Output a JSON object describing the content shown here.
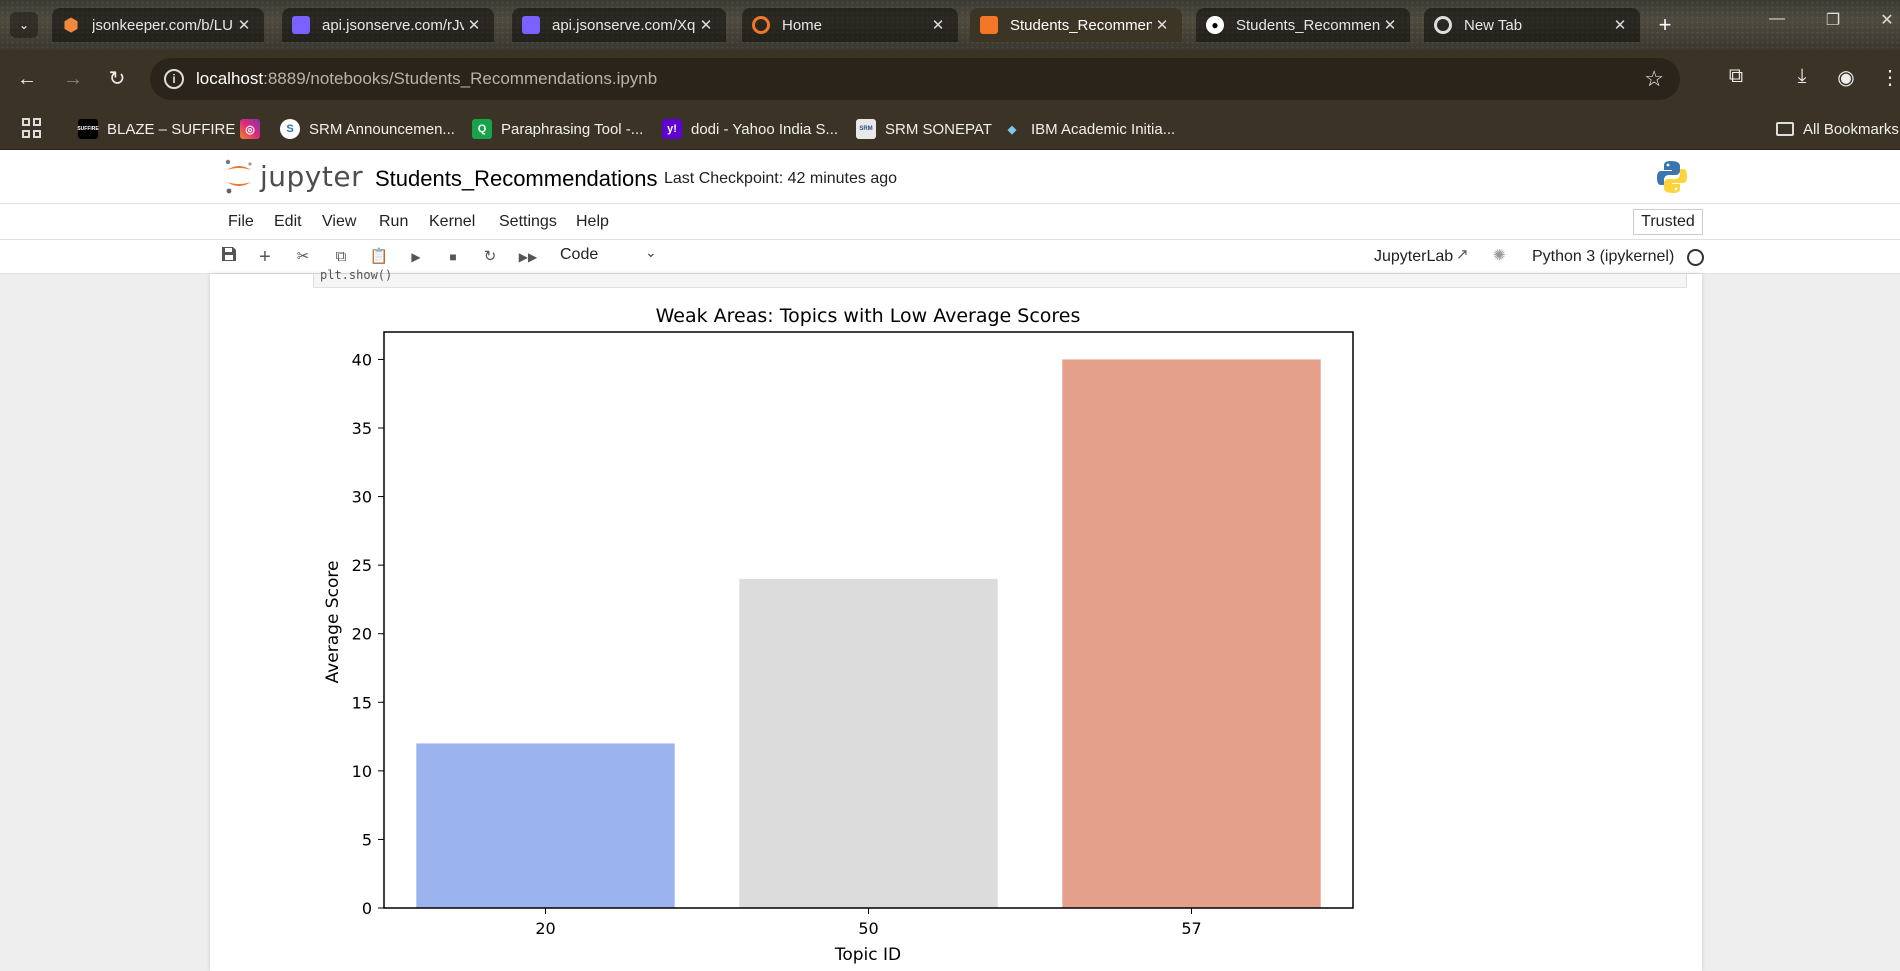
{
  "browser": {
    "tabs": [
      {
        "title": "jsonkeeper.com/b/LU",
        "favicon": "hexagon-icon",
        "color": "#f0883e"
      },
      {
        "title": "api.jsonserve.com/rJv",
        "favicon": "jsonserve-icon",
        "color": "#7b61ff"
      },
      {
        "title": "api.jsonserve.com/Xq",
        "favicon": "jsonserve-icon",
        "color": "#7b61ff"
      },
      {
        "title": "Home",
        "favicon": "jupyter-icon",
        "color": "#f37726"
      },
      {
        "title": "Students_Recommen",
        "favicon": "notebook-icon",
        "color": "#f37726"
      },
      {
        "title": "Students_Recommen",
        "favicon": "github-icon",
        "color": "#ffffff"
      },
      {
        "title": "New Tab",
        "favicon": "chrome-icon",
        "color": "#dddddd"
      }
    ],
    "url_host": "localhost",
    "url_rest": ":8889/notebooks/Students_Recommendations.ipynb",
    "bookmarks": [
      {
        "label": "BLAZE – SUFFIRE",
        "badge": "SUFFIRE",
        "color": "#000000"
      },
      {
        "label": "",
        "badge": "◎",
        "color": "#d6249f"
      },
      {
        "label": "SRM Announcemen...",
        "badge": "S",
        "color": "#2a6fb0"
      },
      {
        "label": "Paraphrasing Tool -...",
        "badge": "Q",
        "color": "#16a34a"
      },
      {
        "label": "dodi - Yahoo India S...",
        "badge": "y!",
        "color": "#5f01d1"
      },
      {
        "label": "SRM SONEPAT",
        "badge": "SRM",
        "color": "#e8e8e8"
      },
      {
        "label": "IBM Academic Initia...",
        "badge": "◆",
        "color": "#2f6f8f"
      }
    ],
    "all_bookmarks": "All Bookmarks"
  },
  "jupyter": {
    "logo_text": "jupyter",
    "notebook_title": "Students_Recommendations",
    "checkpoint": "Last Checkpoint: 42 minutes ago",
    "menu": [
      "File",
      "Edit",
      "View",
      "Run",
      "Kernel",
      "Settings",
      "Help"
    ],
    "trusted": "Trusted",
    "cell_type": "Code",
    "jupyterlab_label": "JupyterLab",
    "kernel": "Python 3 (ipykernel)",
    "prev_cell_text": "plt.show()"
  },
  "chart_data": {
    "type": "bar",
    "title": "Weak Areas: Topics with Low Average Scores",
    "xlabel": "Topic ID",
    "ylabel": "Average Score",
    "categories": [
      "20",
      "50",
      "57"
    ],
    "values": [
      12,
      24,
      40
    ],
    "colors": [
      "#9bb3ee",
      "#dcdcdc",
      "#e4a08a"
    ],
    "ylim": [
      0,
      42
    ],
    "yticks": [
      0,
      5,
      10,
      15,
      20,
      25,
      30,
      35,
      40
    ],
    "grid": false
  }
}
